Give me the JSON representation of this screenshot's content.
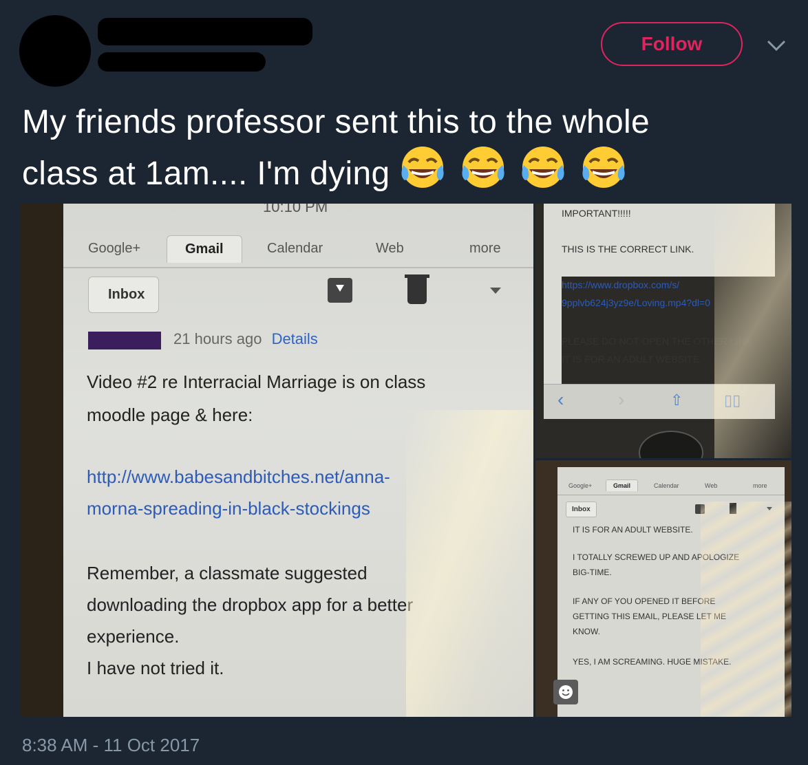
{
  "header": {
    "follow_label": "Follow"
  },
  "tweet": {
    "text_line1": "My friends professor sent this to the whole",
    "text_line2": "class at 1am.... I'm dying",
    "emoji_name": "face-with-tears-of-joy",
    "timestamp": "8:38 AM - 11 Oct 2017"
  },
  "photo1": {
    "status_time": "10:10 PM",
    "tabs": [
      "Google+",
      "Gmail",
      "Calendar",
      "Web",
      "more"
    ],
    "active_tab": "Gmail",
    "inbox_label": "Inbox",
    "meta_time": "21 hours ago",
    "meta_details": "Details",
    "line1": "Video #2 re Interracial Marriage is on class",
    "line2": "moodle page & here:",
    "link1": "http://www.babesandbitches.net/anna-",
    "link2": "morna-spreading-in-black-stockings",
    "line3": "Remember, a classmate suggested",
    "line4": "downloading the dropbox app for a better",
    "line5": "experience.",
    "line6": "I have not tried it."
  },
  "photo2": {
    "heading": "IMPORTANT!!!!!",
    "line1": "THIS IS THE CORRECT LINK.",
    "link1": "https://www.dropbox.com/s/",
    "link2": "9pplvb624j3yz9e/Loving.mp4?dl=0",
    "line2": "PLEASE DO NOT OPEN THE OTHER LINK",
    "line3": "IT IS FOR AN ADULT WEBSITE."
  },
  "photo3": {
    "tabs": [
      "Google+",
      "Gmail",
      "Calendar",
      "Web",
      "more"
    ],
    "inbox_label": "Inbox",
    "line1": "IT IS FOR AN ADULT WEBSITE.",
    "line2": "I TOTALLY SCREWED UP AND APOLOGIZE",
    "line3": "BIG-TIME.",
    "line4": "IF ANY OF YOU OPENED IT BEFORE",
    "line5": "GETTING THIS EMAIL, PLEASE LET ME",
    "line6": "KNOW.",
    "line7": "YES, I AM SCREAMING. HUGE MISTAKE."
  },
  "colors": {
    "background": "#1c2532",
    "follow_accent": "#e0245e",
    "timestamp": "#8899a6",
    "link": "#2c5bb8"
  }
}
